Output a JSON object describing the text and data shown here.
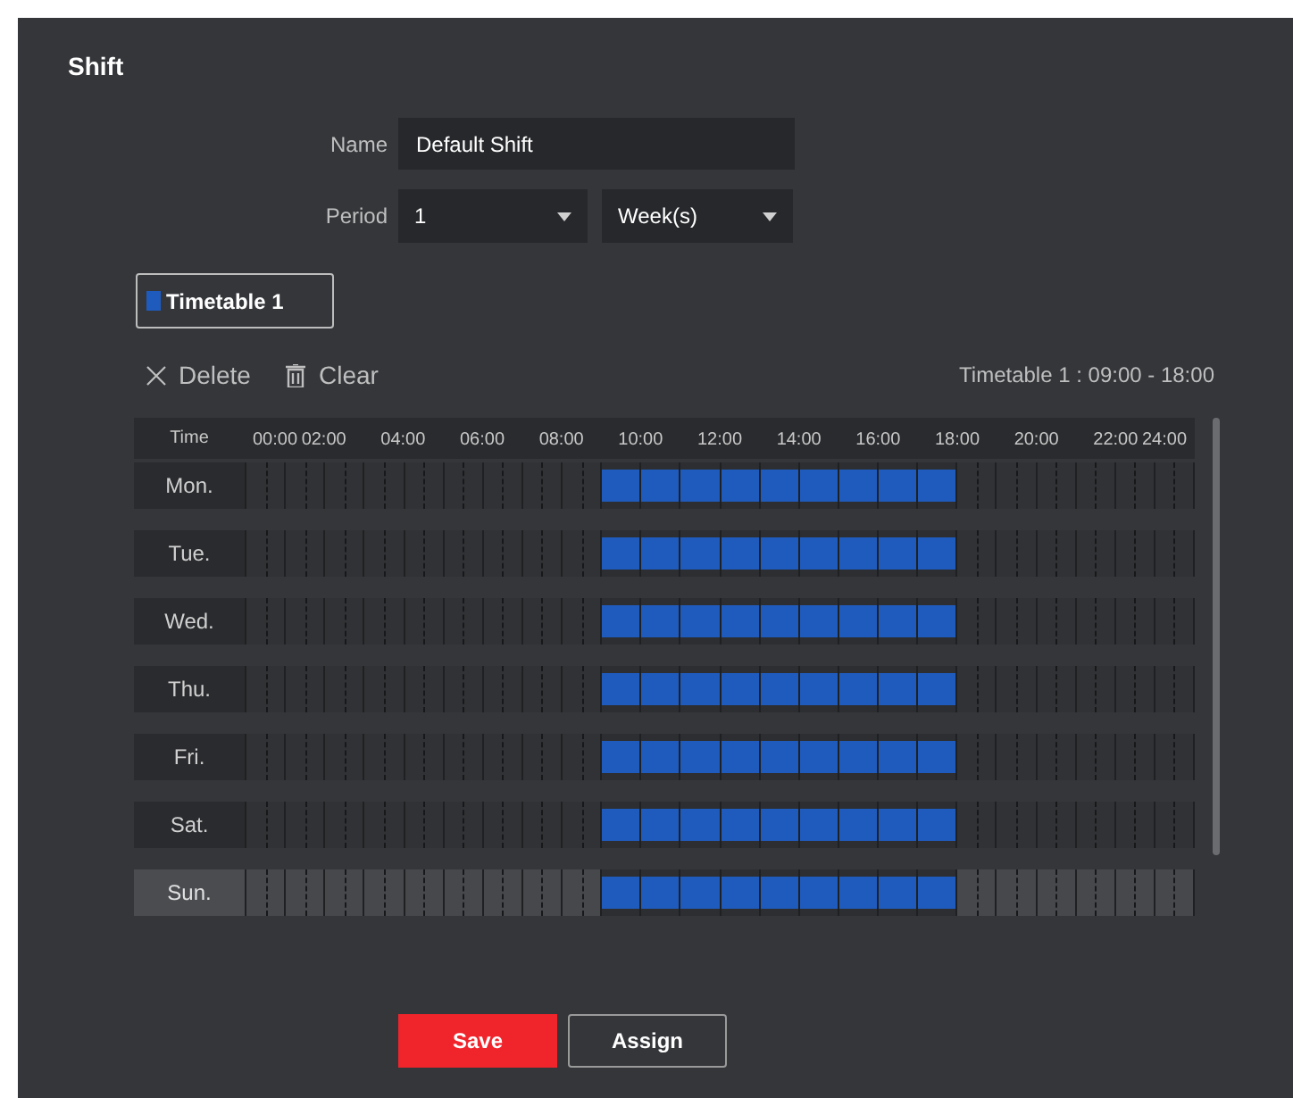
{
  "title": "Shift",
  "name_field": {
    "label": "Name",
    "value": "Default Shift"
  },
  "period": {
    "label": "Period",
    "count": "1",
    "unit": "Week(s)"
  },
  "timetables": [
    {
      "label": "Timetable 1",
      "selected": true,
      "color": "#1f5bbd"
    }
  ],
  "toolbar": {
    "delete": "Delete",
    "clear": "Clear",
    "summary": "Timetable 1 : 09:00 - 18:00"
  },
  "schedule": {
    "time_header": "Time",
    "hours": [
      "00:00",
      "02:00",
      "04:00",
      "06:00",
      "08:00",
      "10:00",
      "12:00",
      "14:00",
      "16:00",
      "18:00",
      "20:00",
      "22:00",
      "24:00"
    ],
    "rows": [
      {
        "day": "Mon.",
        "selected": false,
        "hour_slots": [
          false,
          false,
          false,
          false,
          false,
          false,
          false,
          false,
          false,
          true,
          true,
          true,
          true,
          true,
          true,
          true,
          true,
          true,
          false,
          false,
          false,
          false,
          false,
          false
        ]
      },
      {
        "day": "Tue.",
        "selected": false,
        "hour_slots": [
          false,
          false,
          false,
          false,
          false,
          false,
          false,
          false,
          false,
          true,
          true,
          true,
          true,
          true,
          true,
          true,
          true,
          true,
          false,
          false,
          false,
          false,
          false,
          false
        ]
      },
      {
        "day": "Wed.",
        "selected": false,
        "hour_slots": [
          false,
          false,
          false,
          false,
          false,
          false,
          false,
          false,
          false,
          true,
          true,
          true,
          true,
          true,
          true,
          true,
          true,
          true,
          false,
          false,
          false,
          false,
          false,
          false
        ]
      },
      {
        "day": "Thu.",
        "selected": false,
        "hour_slots": [
          false,
          false,
          false,
          false,
          false,
          false,
          false,
          false,
          false,
          true,
          true,
          true,
          true,
          true,
          true,
          true,
          true,
          true,
          false,
          false,
          false,
          false,
          false,
          false
        ]
      },
      {
        "day": "Fri.",
        "selected": false,
        "hour_slots": [
          false,
          false,
          false,
          false,
          false,
          false,
          false,
          false,
          false,
          true,
          true,
          true,
          true,
          true,
          true,
          true,
          true,
          true,
          false,
          false,
          false,
          false,
          false,
          false
        ]
      },
      {
        "day": "Sat.",
        "selected": false,
        "hour_slots": [
          false,
          false,
          false,
          false,
          false,
          false,
          false,
          false,
          false,
          true,
          true,
          true,
          true,
          true,
          true,
          true,
          true,
          true,
          false,
          false,
          false,
          false,
          false,
          false
        ]
      },
      {
        "day": "Sun.",
        "selected": true,
        "hour_slots": [
          false,
          false,
          false,
          false,
          false,
          false,
          false,
          false,
          false,
          true,
          true,
          true,
          true,
          true,
          true,
          true,
          true,
          true,
          false,
          false,
          false,
          false,
          false,
          false
        ]
      }
    ]
  },
  "buttons": {
    "save": "Save",
    "assign": "Assign"
  }
}
